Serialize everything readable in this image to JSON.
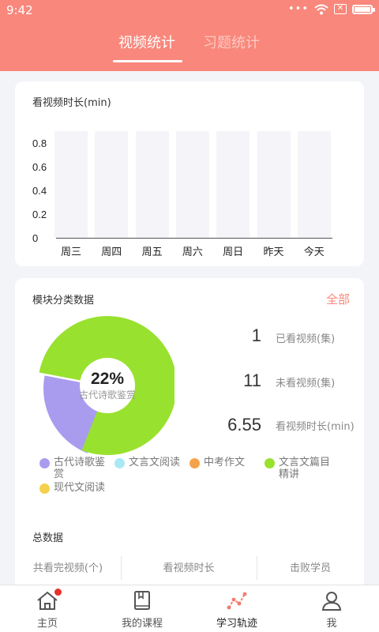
{
  "status_bar": {
    "time": "9:42",
    "dots": "•••"
  },
  "tabs": [
    {
      "label": "视频统计",
      "active": true
    },
    {
      "label": "习题统计",
      "active": false
    }
  ],
  "video_card": {
    "title": "看视频时长(min)"
  },
  "chart_data": {
    "type": "bar",
    "categories": [
      "周三",
      "周四",
      "周五",
      "周六",
      "周日",
      "昨天",
      "今天"
    ],
    "values": [
      0,
      0,
      0,
      0,
      0,
      0,
      0
    ],
    "title": "看视频时长(min)",
    "yticks": [
      "0.8",
      "0.6",
      "0.4",
      "0.2",
      "0"
    ],
    "ylim": [
      0,
      0.8
    ],
    "grid": false,
    "bar_color": "#f4f4f9"
  },
  "module_card": {
    "title": "模块分类数据",
    "all_link": "全部",
    "donut": {
      "percent_label": "22%",
      "center_label": "古代诗歌鉴赏",
      "slices": [
        {
          "name": "古代诗歌鉴赏",
          "fraction": 0.22,
          "color": "#a99cef"
        },
        {
          "name": "文言文篇目精讲",
          "fraction": 0.78,
          "color": "#99e12f"
        }
      ]
    },
    "stats": [
      {
        "value": "1",
        "label": "已看视频(集)"
      },
      {
        "value": "11",
        "label": "未看视频(集)"
      },
      {
        "value": "6.55",
        "label": "看视频时长(min)"
      }
    ],
    "legend": [
      {
        "label_line1": "古代诗歌鉴",
        "label_line2": "赏",
        "color": "#a99cef"
      },
      {
        "label_line1": "文言文阅读",
        "label_line2": "",
        "color": "#a9e9f5"
      },
      {
        "label_line1": "中考作文",
        "label_line2": "",
        "color": "#f5a34a"
      },
      {
        "label_line1": "文言文篇目",
        "label_line2": "精讲",
        "color": "#99e12f"
      },
      {
        "label_line1": "现代文阅读",
        "label_line2": "",
        "color": "#f5d04a"
      }
    ],
    "totals": {
      "title": "总数据",
      "columns": [
        "共看完视频(个)",
        "看视频时长",
        "击败学员"
      ]
    }
  },
  "nav": [
    {
      "label": "主页",
      "icon": "home-icon",
      "badge": true
    },
    {
      "label": "我的课程",
      "icon": "book-icon",
      "badge": false
    },
    {
      "label": "学习轨迹",
      "icon": "trend-icon",
      "badge": false,
      "active": true
    },
    {
      "label": "我",
      "icon": "user-icon",
      "badge": false
    }
  ],
  "colors": {
    "header": "#f9877b",
    "accent": "#f9877b",
    "badge": "#e8312a"
  }
}
